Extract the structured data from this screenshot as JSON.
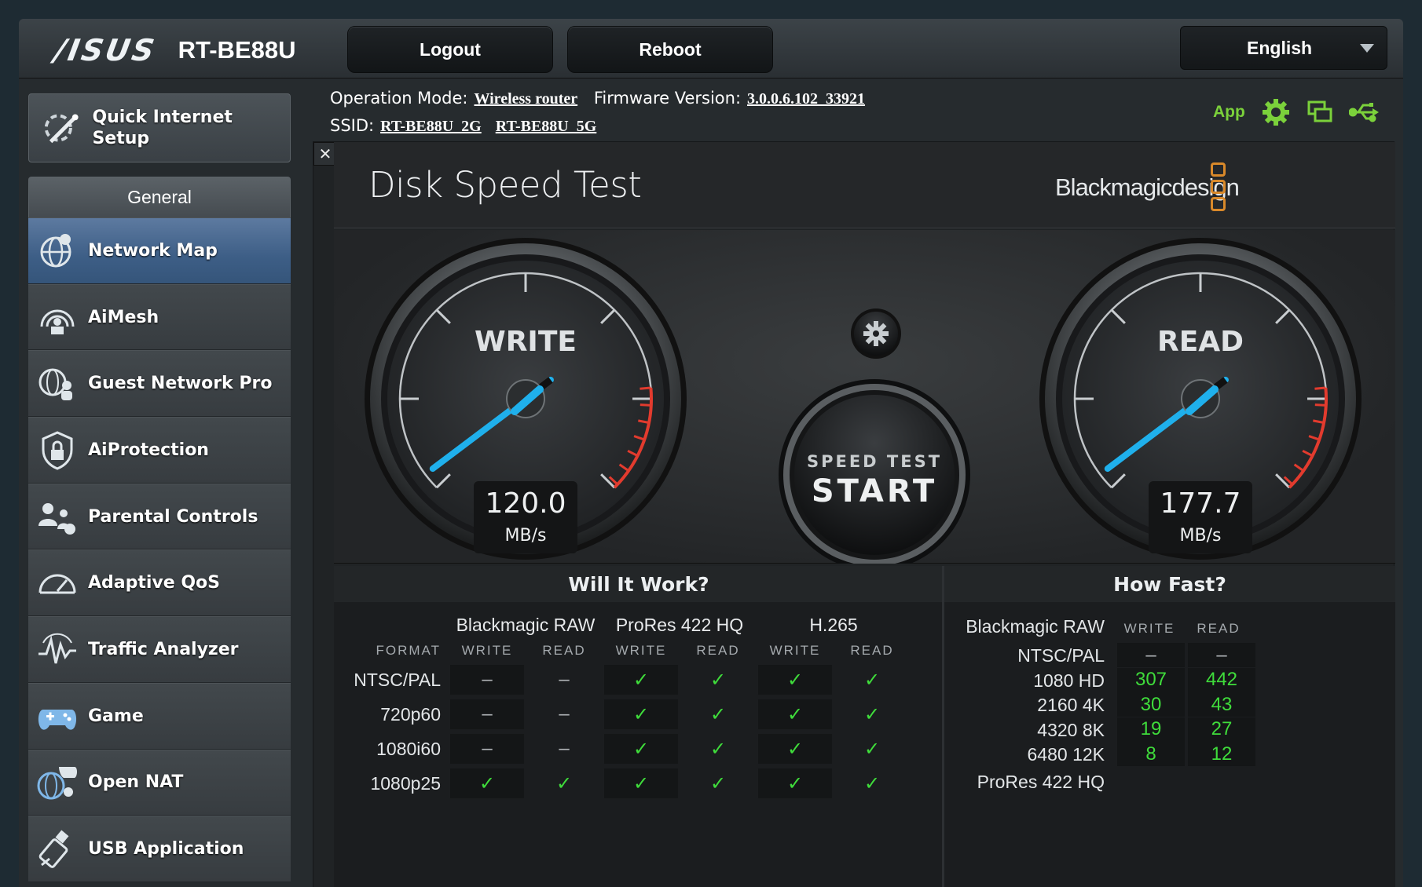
{
  "header": {
    "brand": "/ISUS",
    "model": "RT-BE88U",
    "logout_label": "Logout",
    "reboot_label": "Reboot",
    "language": "English"
  },
  "info": {
    "operation_mode_label": "Operation Mode:",
    "operation_mode_value": "Wireless router",
    "firmware_label": "Firmware Version:",
    "firmware_value": "3.0.0.6.102_33921",
    "ssid_label": "SSID:",
    "ssid_2g": "RT-BE88U_2G",
    "ssid_5g": "RT-BE88U_5G",
    "app_label": "App"
  },
  "sidebar": {
    "quick_setup": "Quick Internet Setup",
    "general_header": "General",
    "items": [
      {
        "label": "Network Map",
        "icon": "network-map-icon",
        "active": true
      },
      {
        "label": "AiMesh",
        "icon": "aimesh-icon"
      },
      {
        "label": "Guest Network Pro",
        "icon": "guest-network-icon"
      },
      {
        "label": "AiProtection",
        "icon": "shield-lock-icon"
      },
      {
        "label": "Parental Controls",
        "icon": "parental-controls-icon"
      },
      {
        "label": "Adaptive QoS",
        "icon": "speedometer-icon"
      },
      {
        "label": "Traffic Analyzer",
        "icon": "traffic-analyzer-icon"
      },
      {
        "label": "Game",
        "icon": "gamepad-icon"
      },
      {
        "label": "Open NAT",
        "icon": "open-nat-icon"
      },
      {
        "label": "USB Application",
        "icon": "usb-app-icon"
      }
    ]
  },
  "disk_test": {
    "close_label": "✕",
    "title": "Disk Speed Test",
    "brand": "Blackmagicdesign",
    "write_label": "WRITE",
    "write_value": "120.0",
    "write_unit": "MB/s",
    "read_label": "READ",
    "read_value": "177.7",
    "read_unit": "MB/s",
    "start_top": "SPEED TEST",
    "start_main": "START",
    "brand_color": "#d9892a",
    "needle_color": "#1fb0ec",
    "redline_color": "#e23b2e"
  },
  "will_it_work": {
    "title": "Will It Work?",
    "format_label": "FORMAT",
    "groups": [
      "Blackmagic RAW",
      "ProRes 422 HQ",
      "H.265"
    ],
    "sub": [
      "WRITE",
      "READ",
      "WRITE",
      "READ",
      "WRITE",
      "READ"
    ],
    "rows": [
      {
        "format": "NTSC/PAL",
        "cells": [
          "–",
          "–",
          "✓",
          "✓",
          "✓",
          "✓"
        ]
      },
      {
        "format": "720p60",
        "cells": [
          "–",
          "–",
          "✓",
          "✓",
          "✓",
          "✓"
        ]
      },
      {
        "format": "1080i60",
        "cells": [
          "–",
          "–",
          "✓",
          "✓",
          "✓",
          "✓"
        ]
      },
      {
        "format": "1080p25",
        "cells": [
          "✓",
          "✓",
          "✓",
          "✓",
          "✓",
          "✓"
        ]
      }
    ]
  },
  "how_fast": {
    "title": "How Fast?",
    "group": "Blackmagic RAW",
    "write_label": "WRITE",
    "read_label": "READ",
    "rows": [
      {
        "format": "NTSC/PAL",
        "write": "–",
        "read": "–"
      },
      {
        "format": "1080 HD",
        "write": "307",
        "read": "442"
      },
      {
        "format": "2160 4K",
        "write": "30",
        "read": "43"
      },
      {
        "format": "4320 8K",
        "write": "19",
        "read": "27"
      },
      {
        "format": "6480 12K",
        "write": "8",
        "read": "12"
      }
    ],
    "next_group": "ProRes 422 HQ"
  }
}
